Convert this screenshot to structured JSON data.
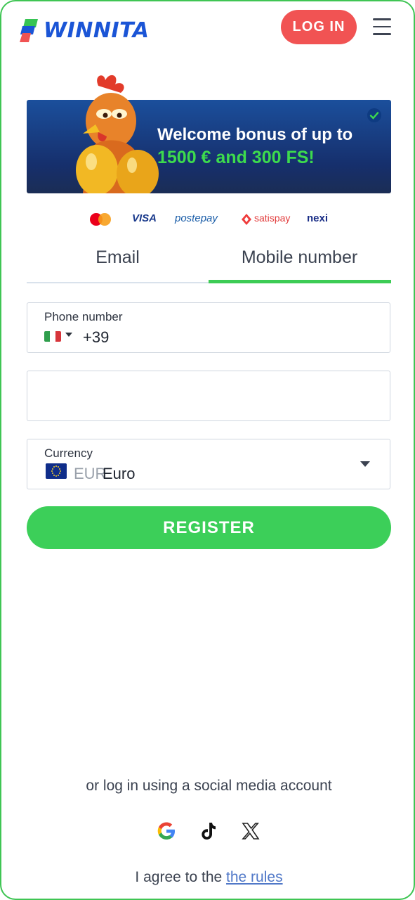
{
  "header": {
    "brand": "WINNITA",
    "login_label": "LOG IN"
  },
  "banner": {
    "line1": "Welcome bonus of up to",
    "line2": "1500 € and 300 FS!"
  },
  "payments": [
    "VISA",
    "postepay",
    "satispay",
    "nexi"
  ],
  "tabs": [
    {
      "label": "Email",
      "active": false
    },
    {
      "label": "Mobile number",
      "active": true
    }
  ],
  "form": {
    "phone": {
      "label": "Phone number",
      "code": "+39"
    },
    "currency": {
      "label": "Currency",
      "code": "EUR",
      "name": "Euro"
    },
    "register_label": "REGISTER"
  },
  "social": {
    "text": "or log in using a social media account",
    "icons": [
      "google-icon",
      "tiktok-icon",
      "x-icon"
    ]
  },
  "agree": {
    "prefix": "I agree to the",
    "link": "the rules"
  },
  "colors": {
    "accent_green": "#3ccf59",
    "login_red": "#f15353",
    "brand_blue": "#1b55d6"
  }
}
